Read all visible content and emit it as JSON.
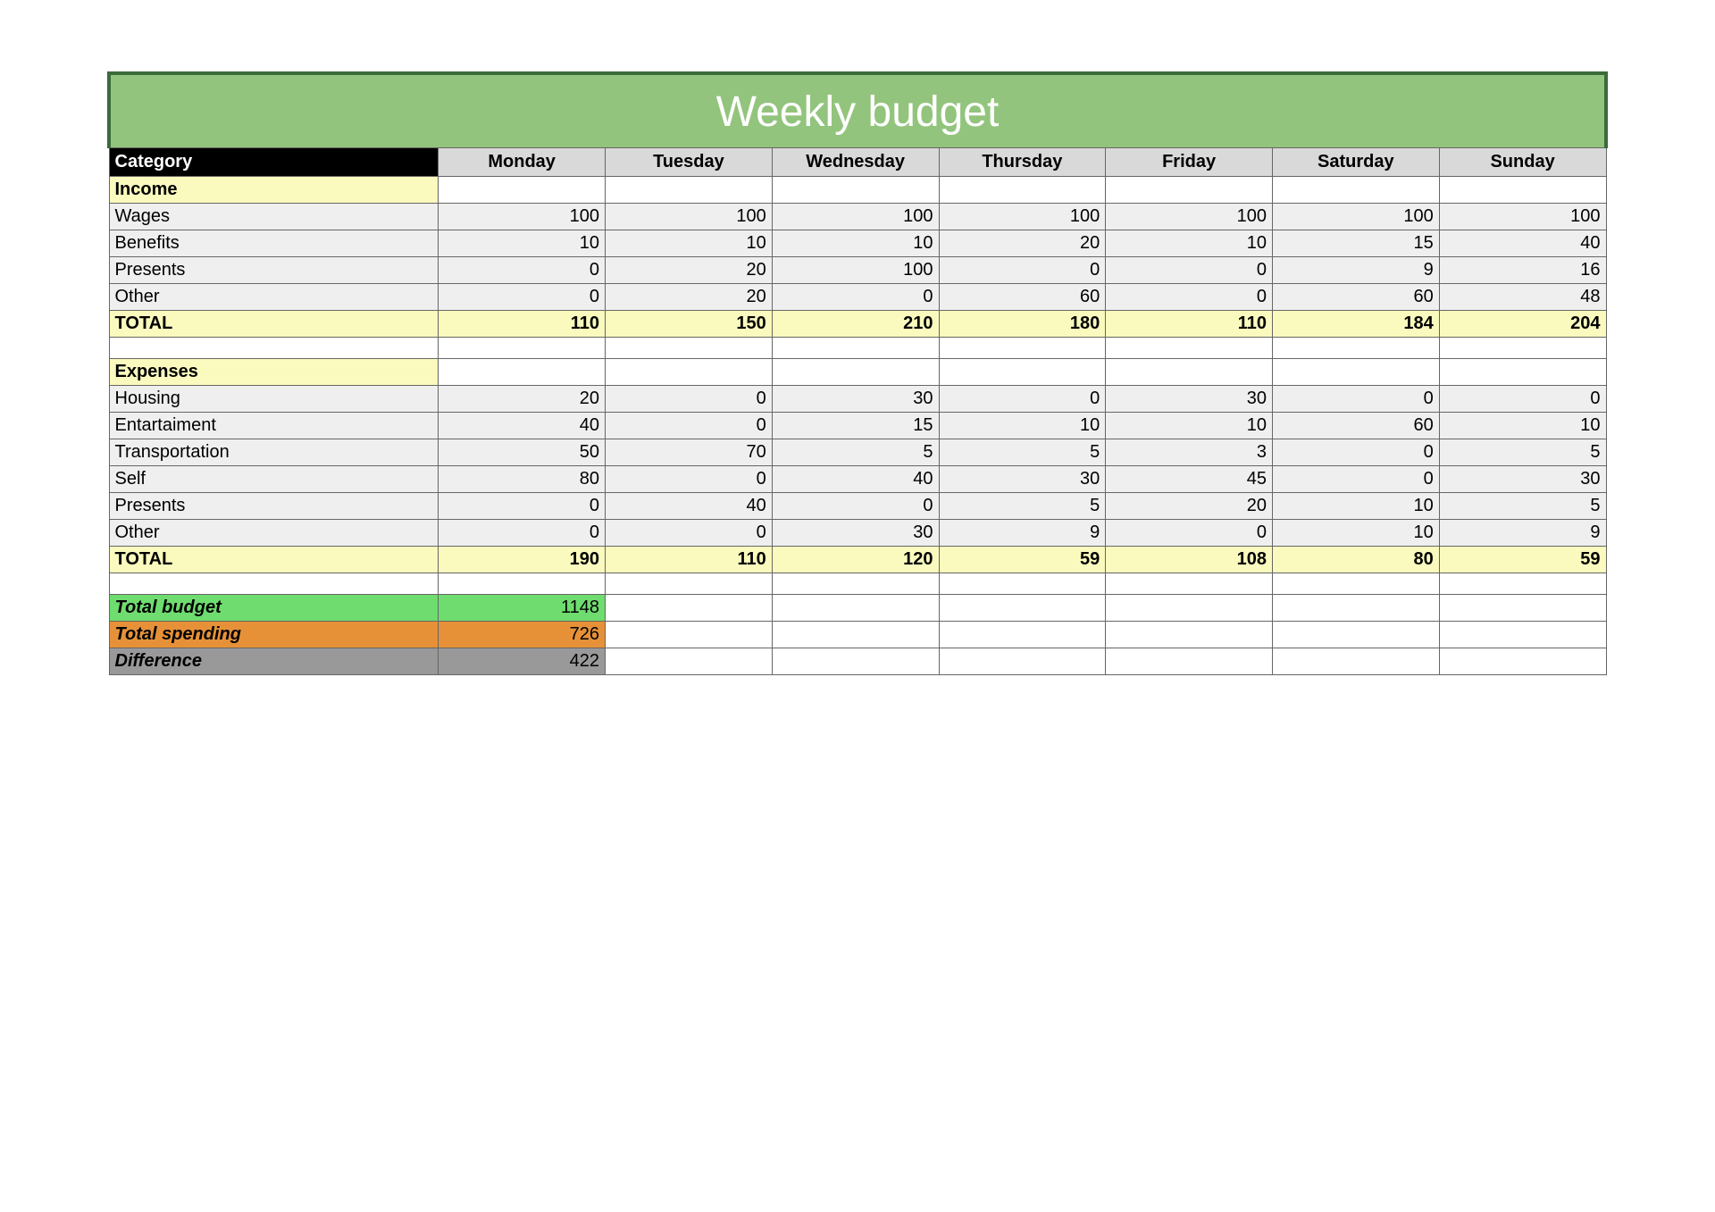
{
  "title": "Weekly budget",
  "header": {
    "category": "Category",
    "days": [
      "Monday",
      "Tuesday",
      "Wednesday",
      "Thursday",
      "Friday",
      "Saturday",
      "Sunday"
    ]
  },
  "income": {
    "section_label": "Income",
    "rows": [
      {
        "label": "Wages",
        "values": [
          100,
          100,
          100,
          100,
          100,
          100,
          100
        ]
      },
      {
        "label": "Benefits",
        "values": [
          10,
          10,
          10,
          20,
          10,
          15,
          40
        ]
      },
      {
        "label": "Presents",
        "values": [
          0,
          20,
          100,
          0,
          0,
          9,
          16
        ]
      },
      {
        "label": "Other",
        "values": [
          0,
          20,
          0,
          60,
          0,
          60,
          48
        ]
      }
    ],
    "total_label": "TOTAL",
    "total_values": [
      110,
      150,
      210,
      180,
      110,
      184,
      204
    ]
  },
  "expenses": {
    "section_label": "Expenses",
    "rows": [
      {
        "label": "Housing",
        "values": [
          20,
          0,
          30,
          0,
          30,
          0,
          0
        ]
      },
      {
        "label": "Entartaiment",
        "values": [
          40,
          0,
          15,
          10,
          10,
          60,
          10
        ]
      },
      {
        "label": "Transportation",
        "values": [
          50,
          70,
          5,
          5,
          3,
          0,
          5
        ]
      },
      {
        "label": "Self",
        "values": [
          80,
          0,
          40,
          30,
          45,
          0,
          30
        ]
      },
      {
        "label": "Presents",
        "values": [
          0,
          40,
          0,
          5,
          20,
          10,
          5
        ]
      },
      {
        "label": "Other",
        "values": [
          0,
          0,
          30,
          9,
          0,
          10,
          9
        ]
      }
    ],
    "total_label": "TOTAL",
    "total_values": [
      190,
      110,
      120,
      59,
      108,
      80,
      59
    ]
  },
  "summary": {
    "total_budget": {
      "label": "Total budget",
      "value": 1148
    },
    "total_spending": {
      "label": "Total spending",
      "value": 726
    },
    "difference": {
      "label": "Difference",
      "value": 422
    }
  }
}
